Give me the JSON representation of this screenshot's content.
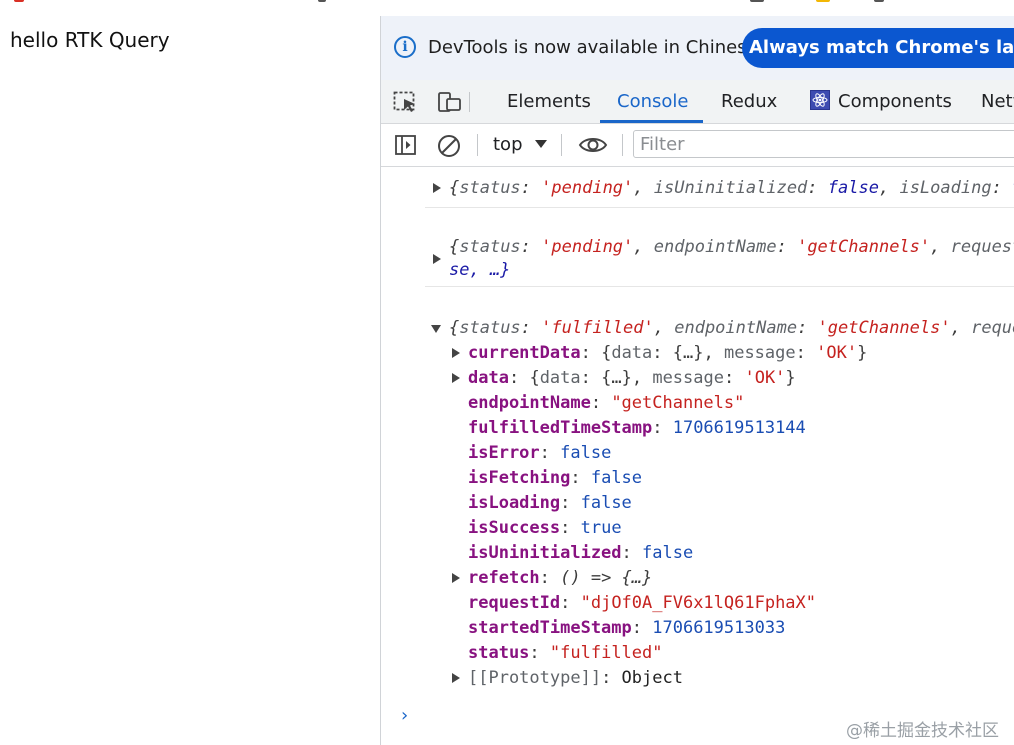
{
  "page": {
    "text": "hello RTK Query"
  },
  "infobar": {
    "message": "DevTools is now available in Chinese!",
    "button_label": "Always match Chrome's language"
  },
  "tabs": {
    "elements": "Elements",
    "console": "Console",
    "redux": "Redux",
    "components": "Components",
    "network": "Network"
  },
  "toolbar": {
    "context": "top",
    "filter_placeholder": "Filter"
  },
  "console": {
    "msg1": {
      "open": "{",
      "k1": "status",
      "v1": "'pending'",
      "k2": "isUninitialized",
      "v2": "false",
      "k3": "isLoading",
      "v3": "true"
    },
    "msg2": {
      "open": "{",
      "k1": "status",
      "v1": "'pending'",
      "k2": "endpointName",
      "v2": "'getChannels'",
      "k3": "requestId",
      "line2": "se, …}"
    },
    "msg3": {
      "open": "{",
      "k1": "status",
      "v1": "'fulfilled'",
      "k2": "endpointName",
      "v2": "'getChannels'",
      "k3": "requestId",
      "props": {
        "currentData_key": "currentData",
        "currentData_val_open": "{",
        "currentData_val_k1": "data",
        "currentData_val_v1": "{…}",
        "currentData_val_k2": "message",
        "currentData_val_v2": "'OK'",
        "currentData_val_close": "}",
        "data_key": "data",
        "data_val_open": "{",
        "data_val_k1": "data",
        "data_val_v1": "{…}",
        "data_val_k2": "message",
        "data_val_v2": "'OK'",
        "data_val_close": "}",
        "endpointName_key": "endpointName",
        "endpointName_val": "\"getChannels\"",
        "fulfilledTimeStamp_key": "fulfilledTimeStamp",
        "fulfilledTimeStamp_val": "1706619513144",
        "isError_key": "isError",
        "isError_val": "false",
        "isFetching_key": "isFetching",
        "isFetching_val": "false",
        "isLoading_key": "isLoading",
        "isLoading_val": "false",
        "isSuccess_key": "isSuccess",
        "isSuccess_val": "true",
        "isUninitialized_key": "isUninitialized",
        "isUninitialized_val": "false",
        "refetch_key": "refetch",
        "refetch_val": "() => {…}",
        "requestId_key": "requestId",
        "requestId_val": "\"djOf0A_FV6x1lQ61FphaX\"",
        "startedTimeStamp_key": "startedTimeStamp",
        "startedTimeStamp_val": "1706619513033",
        "status_key": "status",
        "status_val": "\"fulfilled\"",
        "prototype_key": "[[Prototype]]",
        "prototype_val": "Object"
      }
    },
    "prompt_glyph": "›"
  },
  "watermark": "@稀土掘金技术社区",
  "colors": {
    "accent": "#1a66c9",
    "button_bg": "#0b57d0",
    "string": "#c5221f",
    "property": "#881280",
    "number": "#1a4db3"
  },
  "icons": [
    "element-picker-icon",
    "device-toolbar-icon",
    "sidebar-toggle-icon",
    "clear-console-icon",
    "eye-icon",
    "info-icon",
    "react-components-icon",
    "expand-triangle-icon"
  ]
}
